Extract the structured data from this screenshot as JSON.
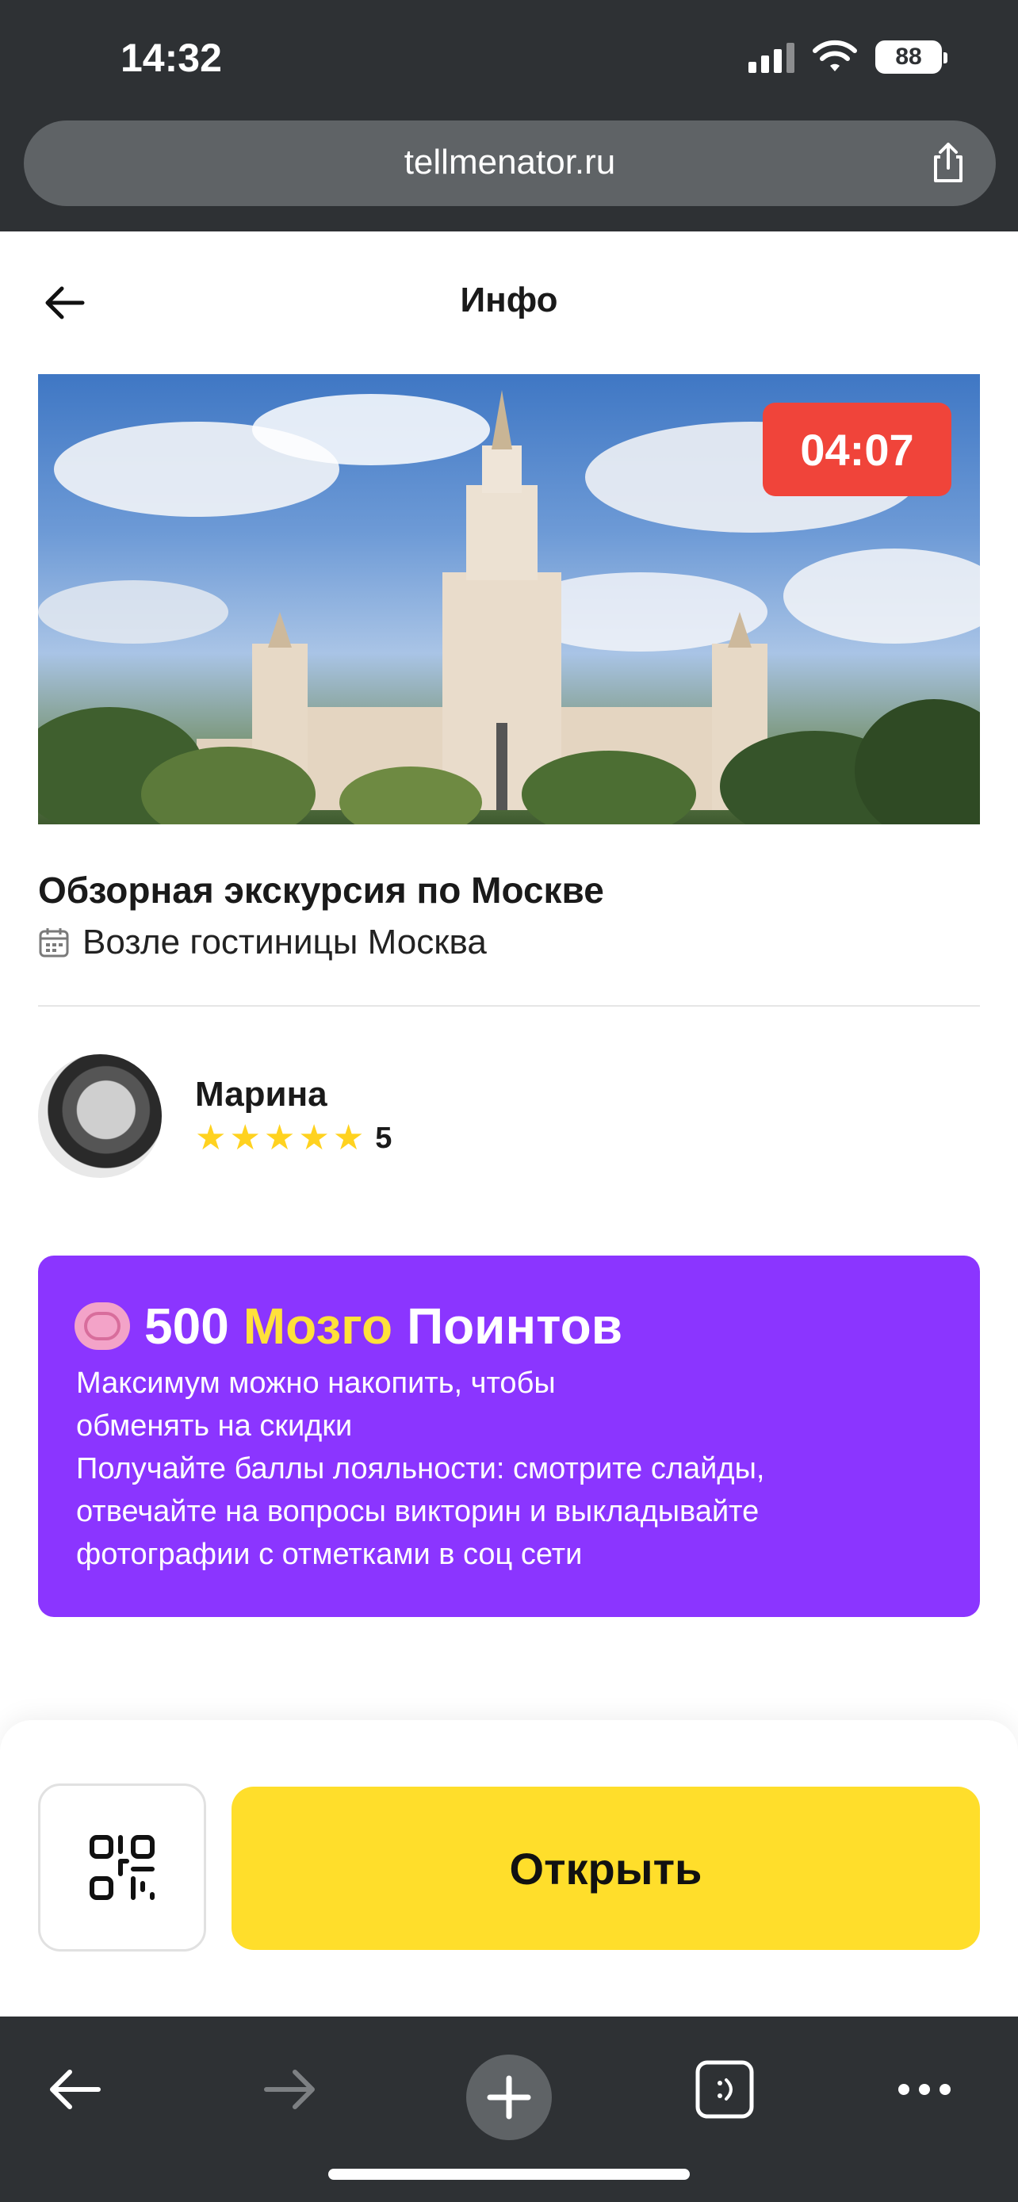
{
  "status_bar": {
    "time": "14:32",
    "battery": "88"
  },
  "browser": {
    "url": "tellmenator.ru"
  },
  "header": {
    "title": "Инфо"
  },
  "hero": {
    "timer": "04:07"
  },
  "tour": {
    "title": "Обзорная экскурсия по Москве",
    "location": "Возле гостиницы Москва"
  },
  "guide": {
    "name": "Марина",
    "rating": "5",
    "stars": 5
  },
  "promo": {
    "amount": "500",
    "brand": "Мозго",
    "suffix": "Поинтов",
    "line1": "Максимум можно накопить, чтобы",
    "line2": "обменять на скидки",
    "line3": "Получайте баллы лояльности: смотрите слайды,",
    "line4": "отвечайте на вопросы викторин и выкладывайте",
    "line5": "фотографии с отметками в соц сети"
  },
  "actions": {
    "open_label": "Открыть"
  },
  "colors": {
    "accent_yellow": "#ffde2b",
    "promo_purple": "#8b35ff",
    "timer_red": "#f0443a",
    "chrome_dark": "#2e3134"
  },
  "icons": [
    "wifi-icon",
    "share-icon",
    "back-arrow-icon",
    "calendar-icon",
    "star-icon",
    "brain-icon",
    "qr-code-icon",
    "browser-back-icon",
    "browser-forward-icon",
    "plus-icon",
    "tabs-icon",
    "more-icon"
  ]
}
